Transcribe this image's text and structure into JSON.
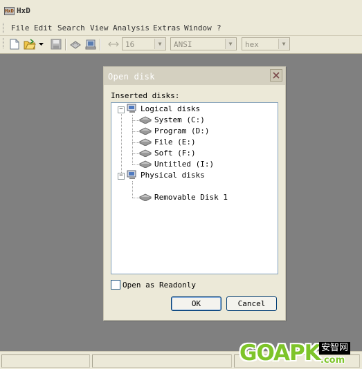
{
  "app": {
    "title": "HxD",
    "logo_text": "HxD"
  },
  "menu": {
    "items": [
      "File",
      "Edit",
      "Search",
      "View",
      "Analysis",
      "Extras",
      "Window",
      "?"
    ]
  },
  "toolbar": {
    "bytes_per_row": "16",
    "charset": "ANSI",
    "offset_base": "hex",
    "icons": [
      "new-file-icon",
      "open-file-icon",
      "dropdown-arrow-icon",
      "save-icon",
      "open-disk-icon",
      "open-ram-icon",
      "columns-icon"
    ]
  },
  "dialog": {
    "title": "Open disk",
    "inserted_label": "Inserted disks:",
    "tree": [
      {
        "label": "Logical disks",
        "type": "group",
        "expanded": true,
        "children": [
          "System (C:)",
          "Program (D:)",
          "File (E:)",
          "Soft (F:)",
          "Untitled (I:)"
        ]
      },
      {
        "label": "Physical disks",
        "type": "group",
        "expanded": true,
        "children": [
          "Removable Disk 1"
        ]
      }
    ],
    "readonly_label": "Open as Readonly",
    "readonly_checked": false,
    "ok_label": "OK",
    "cancel_label": "Cancel"
  },
  "watermark": {
    "brand": "GOAPK",
    "cn": "安智网",
    "domain": ".com"
  },
  "colors": {
    "workspace": "#808080",
    "chrome": "#ece9d8",
    "tree_border": "#7f9db9",
    "button_border": "#003c74"
  }
}
